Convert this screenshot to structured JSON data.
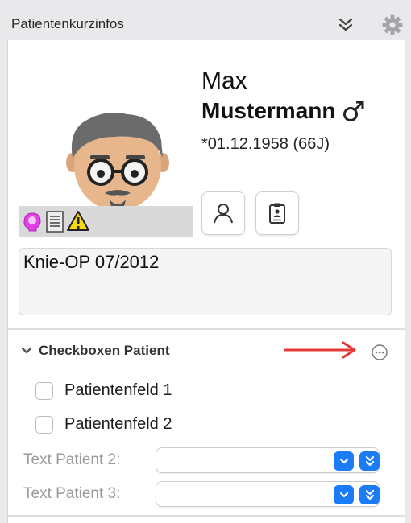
{
  "header": {
    "title": "Patientenkurzinfos"
  },
  "patient": {
    "first_name": "Max",
    "last_name": "Mustermann",
    "birth": "*01.12.1958 (66J)",
    "note": "Knie-OP 07/2012"
  },
  "section": {
    "title": "Checkboxen Patient",
    "checkboxes": [
      "Patientenfeld 1",
      "Patientenfeld 2"
    ],
    "fields": [
      {
        "label": "Text Patient 2:",
        "value": ""
      },
      {
        "label": "Text Patient 3:",
        "value": ""
      }
    ]
  },
  "colors": {
    "accent": "#1b7cf6",
    "annotation_arrow": "#e23a36",
    "badge_magenta": "#e041e6",
    "warning": "#f5d90a"
  },
  "icons": [
    "double-chevron-down-icon",
    "gear-icon",
    "male-symbol-icon",
    "person-icon",
    "clipboard-id-icon",
    "head-bulb-icon",
    "document-icon",
    "warning-icon",
    "chevron-down-icon",
    "ellipsis-circle-icon",
    "double-chevron-icon"
  ]
}
